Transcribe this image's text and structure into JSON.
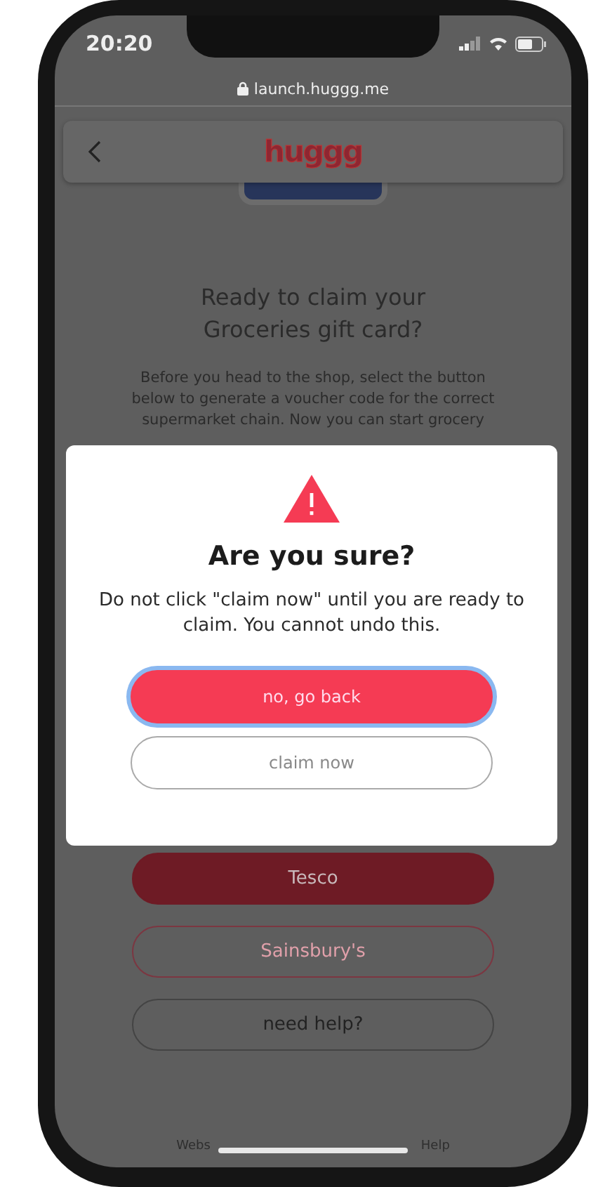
{
  "status_bar": {
    "time": "20:20"
  },
  "address_bar": {
    "url": "launch.huggg.me"
  },
  "header": {
    "logo": "huggg"
  },
  "page": {
    "title": "Ready to claim your Groceries gift card?",
    "description": "Before you head to the shop, select the button below to generate a voucher code for the correct supermarket chain. Now you can start grocery"
  },
  "store_buttons": [
    {
      "label": "Tesco",
      "kind": "filled"
    },
    {
      "label": "Sainsbury's",
      "kind": "outlined"
    },
    {
      "label": "need help?",
      "kind": "plain"
    }
  ],
  "footer": {
    "links": [
      "Webs",
      "Help"
    ]
  },
  "dialog": {
    "title": "Are you sure?",
    "message": "Do not click \"claim now\" until you are ready to claim. You cannot undo this.",
    "buttons": [
      {
        "label": "no, go back",
        "kind": "primary",
        "focused": true
      },
      {
        "label": "claim now",
        "kind": "secondary",
        "focused": false
      }
    ]
  }
}
